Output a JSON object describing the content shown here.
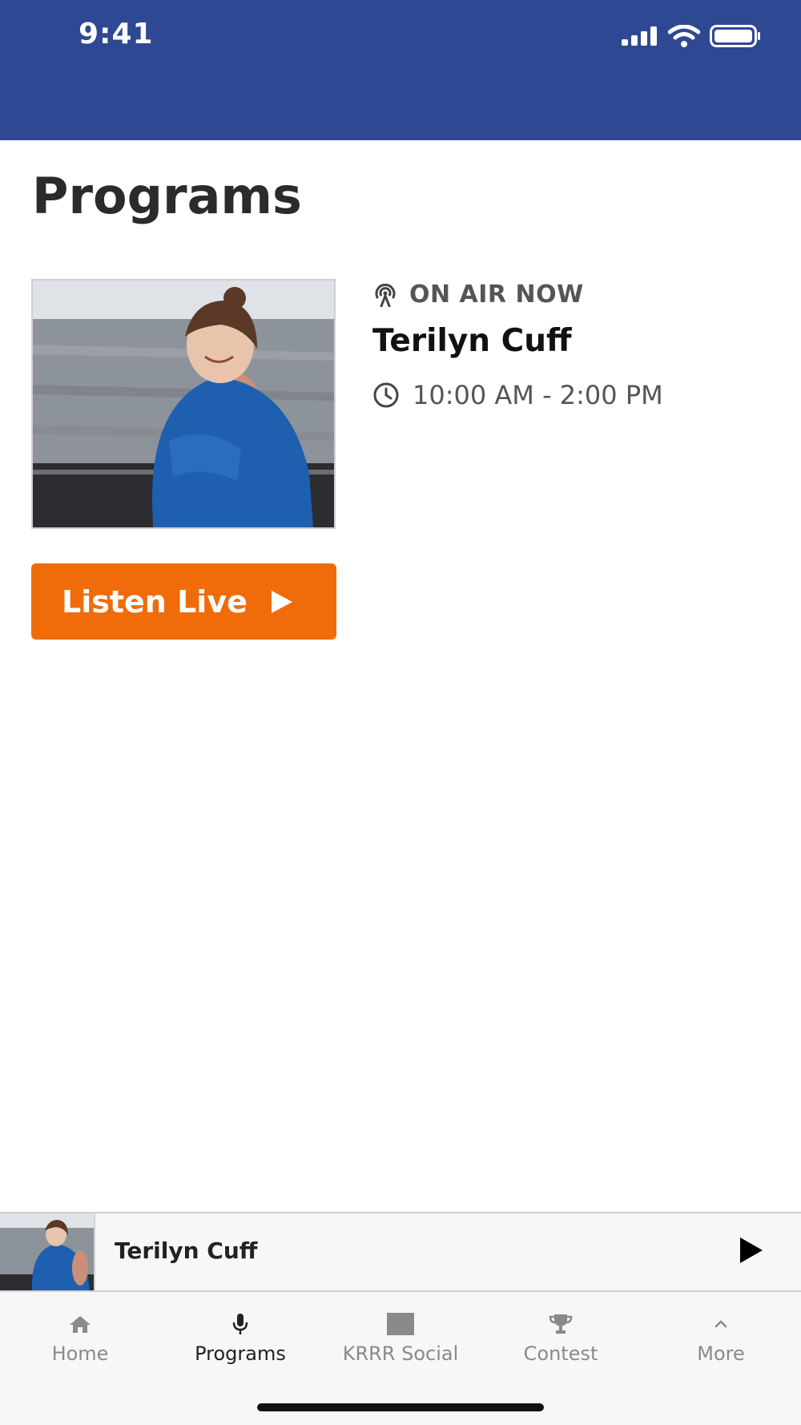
{
  "status_bar": {
    "time": "9:41"
  },
  "page": {
    "title": "Programs"
  },
  "now_playing": {
    "on_air_label": "ON AIR NOW",
    "host": "Terilyn Cuff",
    "time_range": "10:00 AM - 2:00 PM",
    "listen_label": "Listen Live"
  },
  "mini_player": {
    "title": "Terilyn Cuff"
  },
  "tabs": [
    {
      "label": "Home",
      "icon": "home-icon"
    },
    {
      "label": "Programs",
      "icon": "microphone-icon",
      "active": true
    },
    {
      "label": "KRRR Social",
      "icon": "social-icon"
    },
    {
      "label": "Contest",
      "icon": "trophy-icon"
    },
    {
      "label": "More",
      "icon": "chevron-up-icon"
    }
  ],
  "colors": {
    "header": "#2e4893",
    "accent": "#f06c0a",
    "text_dark": "#2b2b2b",
    "text_muted": "#555555",
    "tab_inactive": "#8a8a8a"
  }
}
